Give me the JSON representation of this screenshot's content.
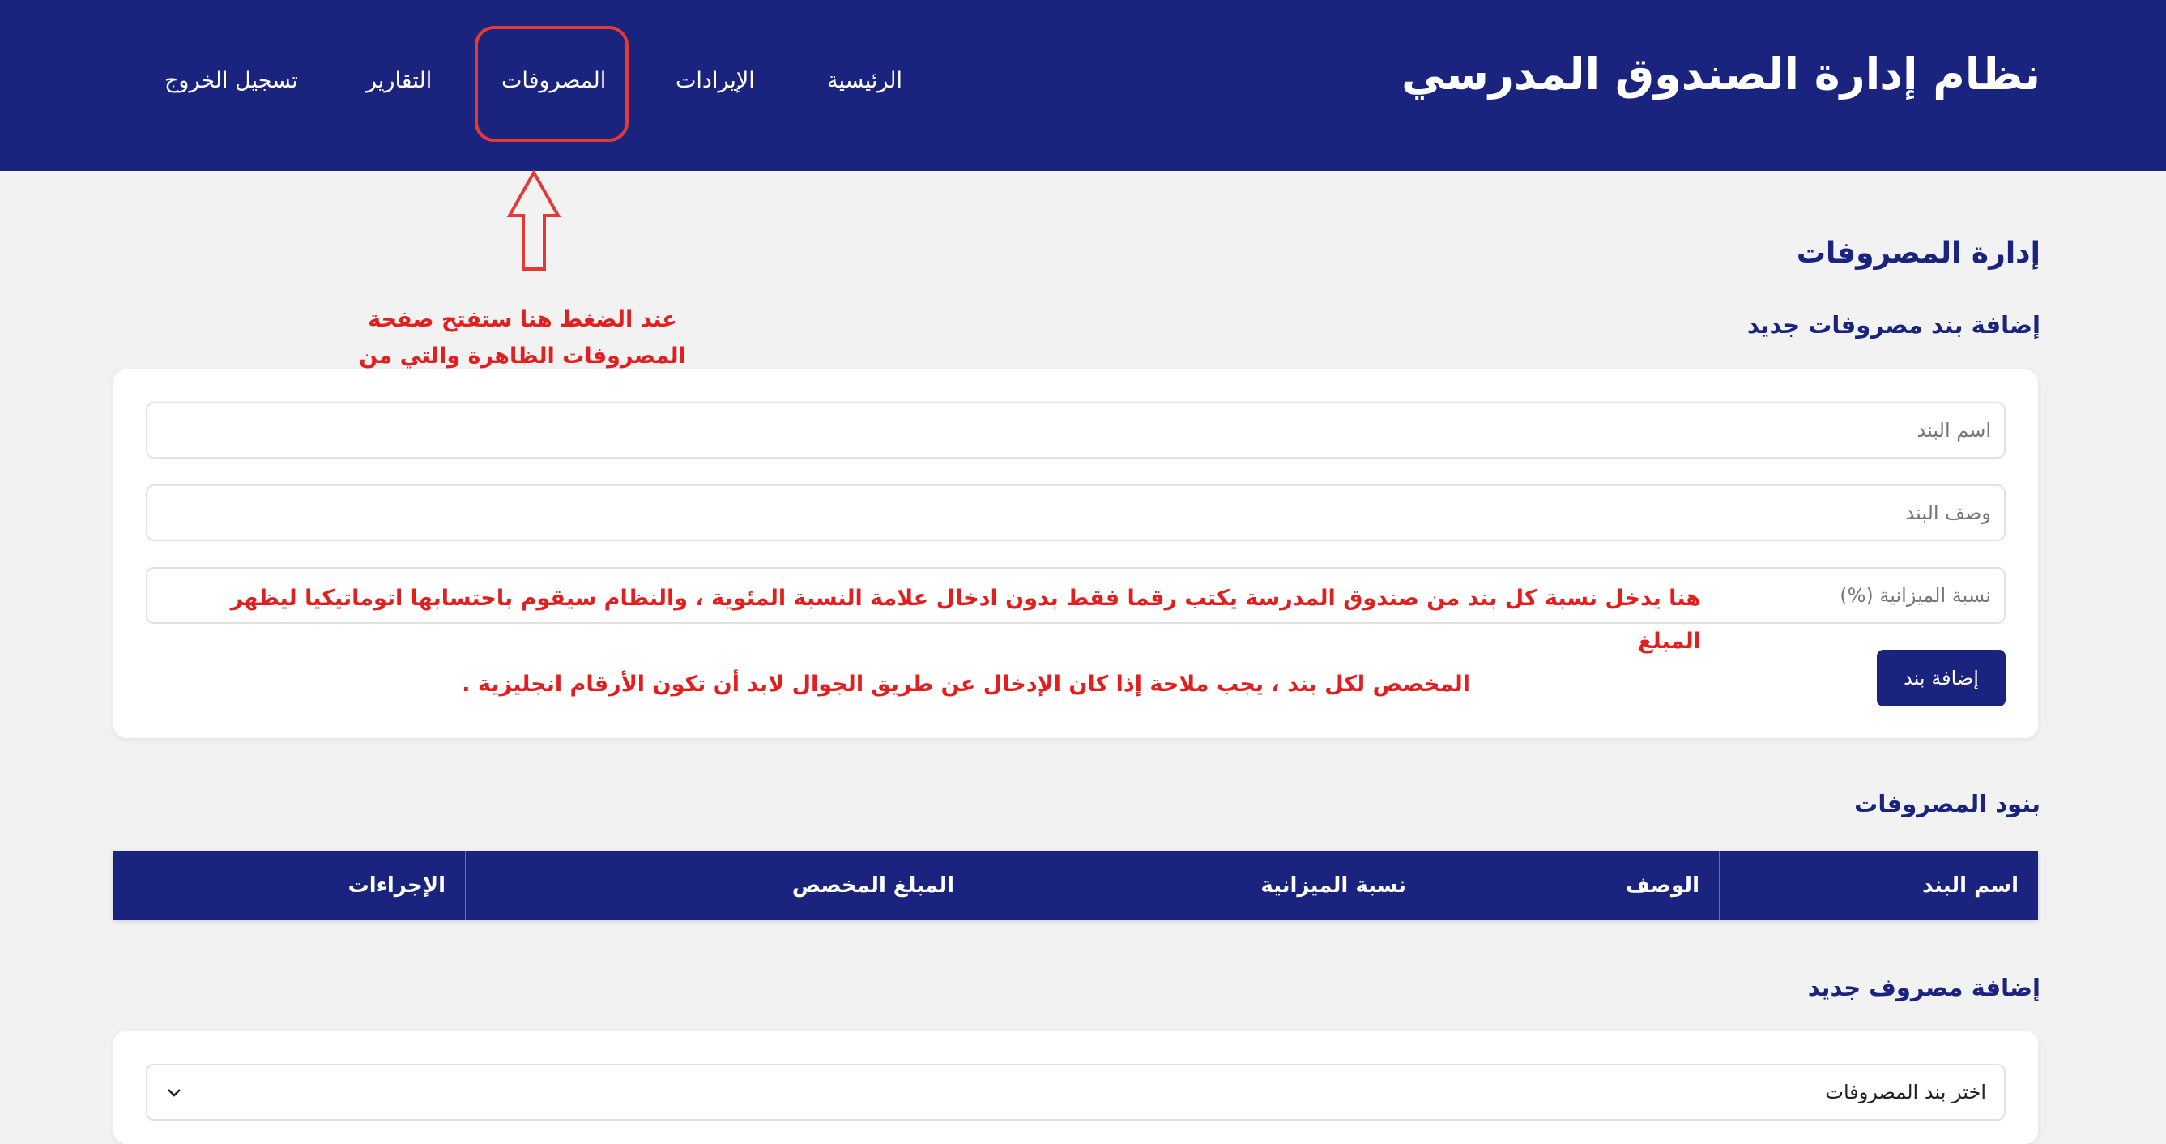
{
  "header": {
    "brand": "نظام إدارة الصندوق المدرسي",
    "nav": {
      "home": "الرئيسية",
      "revenues": "الإيرادات",
      "expenses": "المصروفات",
      "reports": "التقارير",
      "logout": "تسجيل الخروج"
    }
  },
  "annotations": {
    "expenses_note": "عند الضغط هنا ستفتح صفحة المصروفات الظاهرة والتي من خلالها أيضا يمكن إدخال بنود الصرف الصادرة بتعميم من الإدارة",
    "percent_note_line1": "هنا يدخل نسبة كل بند من صندوق المدرسة يكتب رقما فقط بدون ادخال علامة النسبة المئوية ، والنظام سيقوم باحتسابها اتوماتيكيا ليظهر المبلغ",
    "percent_note_line2": "المخصص لكل بند ، يجب ملاحة إذا كان الإدخال عن طريق الجوال لابد أن تكون الأرقام انجليزية .",
    "color": "#e21f1f"
  },
  "page": {
    "title": "إدارة المصروفات",
    "add_item_section": "إضافة بند مصروفات جديد",
    "form": {
      "name_placeholder": "اسم البند",
      "desc_placeholder": "وصف البند",
      "percent_placeholder": "نسبة الميزانية (%)",
      "add_button": "إضافة بند"
    },
    "items_section": "بنود المصروفات",
    "table": {
      "columns": [
        "اسم البند",
        "الوصف",
        "نسبة الميزانية",
        "المبلغ المخصص",
        "الإجراءات"
      ]
    },
    "add_expense_section": "إضافة مصروف جديد",
    "select_placeholder": "اختر بند المصروفات"
  },
  "theme": {
    "primary": "#1a237e",
    "background": "#f2f2f2",
    "highlight": "#e53935"
  }
}
